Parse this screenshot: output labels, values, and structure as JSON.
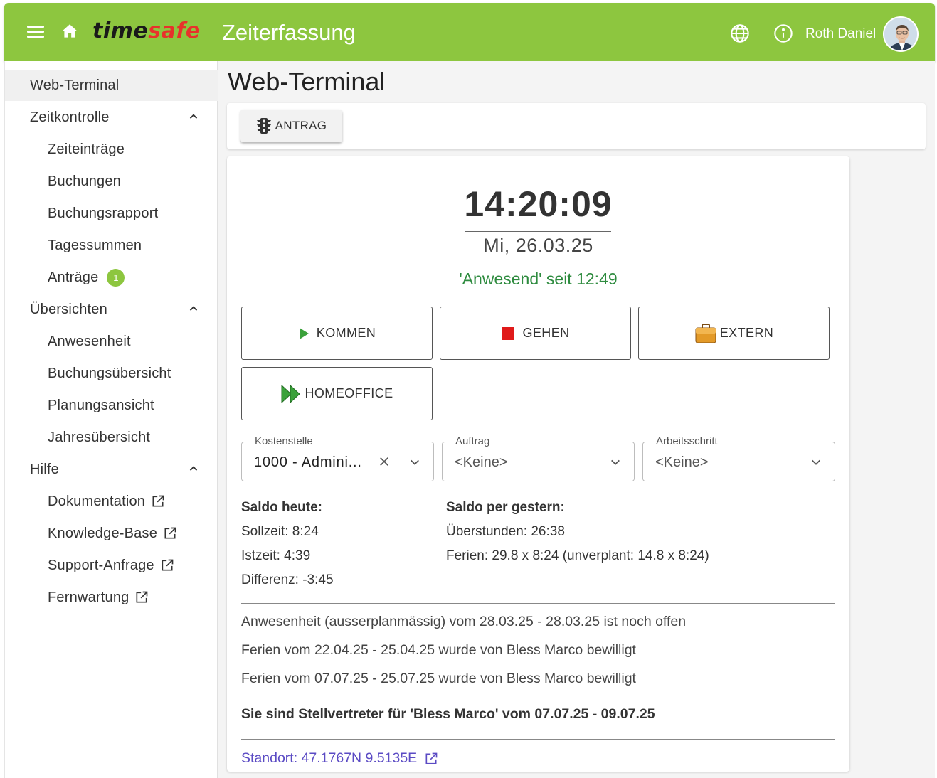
{
  "header": {
    "logo_part1": "time",
    "logo_part2": "safe",
    "app_title": "Zeiterfassung",
    "user_name": "Roth Daniel",
    "icons": [
      "menu-icon",
      "home-icon",
      "globe-icon",
      "info-icon"
    ],
    "brand_color": "#8dc63f"
  },
  "sidebar": {
    "items": [
      {
        "label": "Web-Terminal"
      },
      {
        "label": "Zeitkontrolle"
      },
      {
        "label": "Zeiteinträge"
      },
      {
        "label": "Buchungen"
      },
      {
        "label": "Buchungsrapport"
      },
      {
        "label": "Tagessummen"
      },
      {
        "label": "Anträge",
        "badge": "1"
      },
      {
        "label": "Übersichten"
      },
      {
        "label": "Anwesenheit"
      },
      {
        "label": "Buchungsübersicht"
      },
      {
        "label": "Planungsansicht"
      },
      {
        "label": "Jahresübersicht"
      },
      {
        "label": "Hilfe"
      },
      {
        "label": "Dokumentation"
      },
      {
        "label": "Knowledge-Base"
      },
      {
        "label": "Support-Anfrage"
      },
      {
        "label": "Fernwartung"
      }
    ]
  },
  "main": {
    "page_title": "Web-Terminal",
    "toolbar": {
      "antrag_label": "ANTRAG"
    },
    "clock": {
      "time": "14:20:09",
      "date": "Mi, 26.03.25"
    },
    "status": "'Anwesend' seit 12:49",
    "buttons": {
      "kommen": "KOMMEN",
      "gehen": "GEHEN",
      "extern": "EXTERN",
      "homeoffice": "HOMEOFFICE"
    },
    "fields": {
      "kostenstelle": {
        "label": "Kostenstelle",
        "value": "1000 - Admini..."
      },
      "auftrag": {
        "label": "Auftrag",
        "value": "<Keine>"
      },
      "arbeitsschritt": {
        "label": "Arbeitsschritt",
        "value": "<Keine>"
      }
    },
    "saldo_heute": {
      "title": "Saldo heute:",
      "sollzeit": "Sollzeit: 8:24",
      "istzeit": "Istzeit: 4:39",
      "differenz": "Differenz: -3:45"
    },
    "saldo_gestern": {
      "title": "Saldo per gestern:",
      "ueberstunden": "Überstunden: 26:38",
      "ferien": "Ferien: 29.8 x 8:24 (unverplant: 14.8 x 8:24)"
    },
    "messages": [
      "Anwesenheit (ausserplanmässig) vom 28.03.25 - 28.03.25 ist noch offen",
      "Ferien vom 22.04.25 - 25.04.25 wurde von Bless Marco bewilligt",
      "Ferien vom 07.07.25 - 25.07.25 wurde von Bless Marco bewilligt"
    ],
    "stellvertreter": "Sie sind Stellvertreter für 'Bless Marco' vom 07.07.25 - 09.07.25",
    "standort": "Standort: 47.1767N 9.5135E"
  }
}
